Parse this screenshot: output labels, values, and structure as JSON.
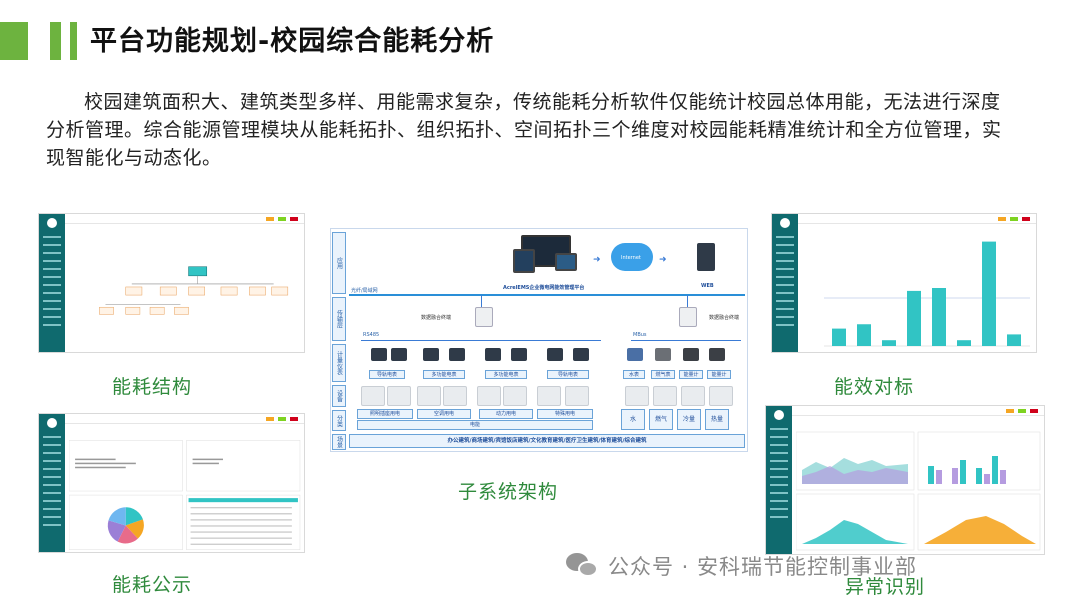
{
  "title": "平台功能规划-校园综合能耗分析",
  "intro": "校园建筑面积大、建筑类型多样、用能需求复杂，传统能耗分析软件仅能统计校园总体用能，无法进行深度分析管理。综合能源管理模块从能耗拓扑、组织拓扑、空间拓扑三个维度对校园能耗精准统计和全方位管理，实现智能化与动态化。",
  "captions": {
    "structure": "能耗结构",
    "benchmark": "能效对标",
    "disclosure": "能耗公示",
    "architecture": "子系统架构",
    "anomaly": "异常识别"
  },
  "architecture": {
    "layers": [
      "应用",
      "传输层",
      "计量仪表",
      "设备",
      "分类",
      "场景"
    ],
    "platform_name": "AcrelEMS企业微电网能效管理平台",
    "internet": "Internet",
    "web": "WEB",
    "network": "光纤/局域网",
    "gateway_left": "数据融合终端",
    "gateway_right": "数据融合终端",
    "rs485": "RS485",
    "mbus": "MBus",
    "meters": [
      "导轨电表",
      "多功能电表",
      "多功能电表",
      "导轨电表",
      "水表",
      "燃气表",
      "能量计",
      "能量计"
    ],
    "categories": [
      "照明插座用电",
      "空调用电",
      "动力用电",
      "特殊用电",
      "水",
      "燃气",
      "冷量",
      "热量"
    ],
    "electricity": "电能",
    "scenes": "办公建筑/商场建筑/宾馆饭店建筑/文化教育建筑/医疗卫生建筑/体育建筑/综合建筑"
  },
  "benchmark_chart": {
    "values": [
      12,
      15,
      4,
      38,
      40,
      4,
      72,
      8
    ]
  },
  "watermark": "公众号 · 安科瑞节能控制事业部",
  "colors": {
    "accent_green": "#6db33f",
    "caption_green": "#2f8a3c",
    "sidebar_teal": "#0f6a6e",
    "bar_teal": "#31c4c4"
  }
}
